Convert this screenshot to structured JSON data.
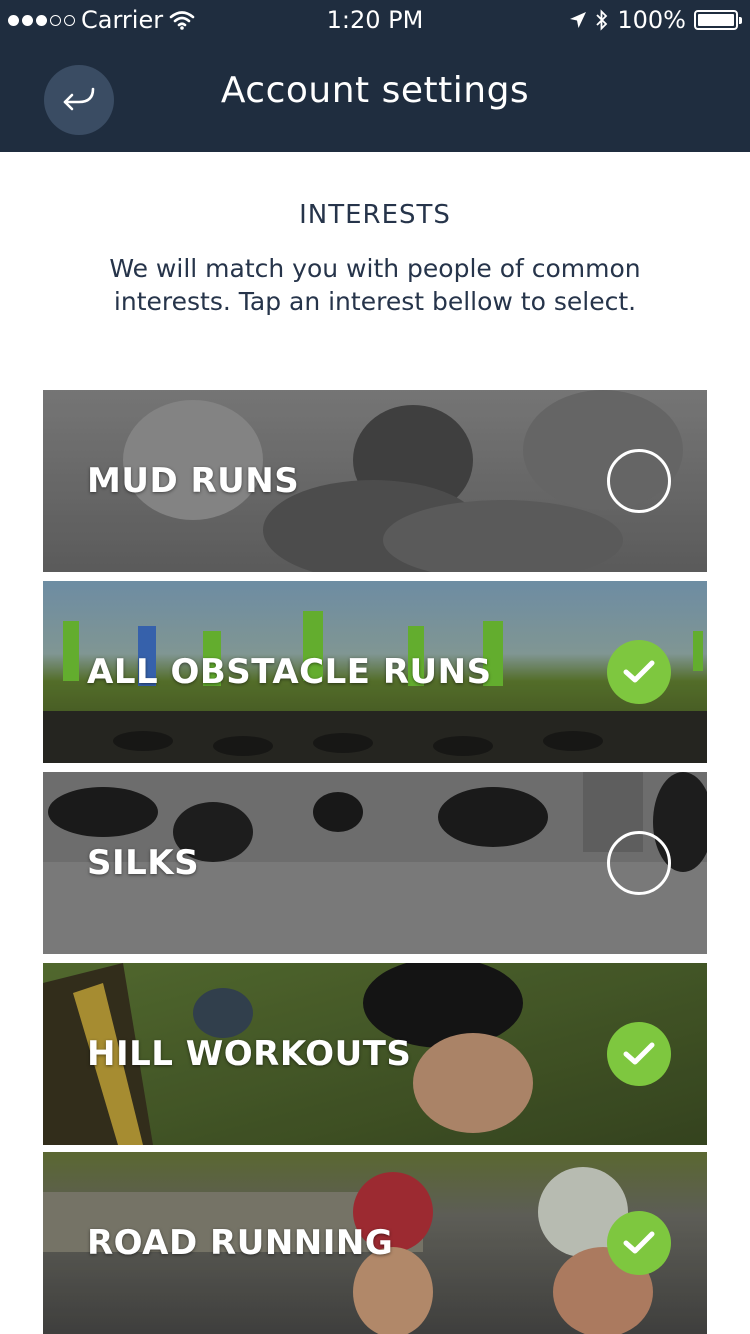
{
  "status_bar": {
    "carrier": "Carrier",
    "time": "1:20 PM",
    "battery": "100%"
  },
  "header": {
    "title": "Account settings"
  },
  "interests": {
    "heading": "INTERESTS",
    "description": "We will match you with people of common interests. Tap an interest bellow to select.",
    "items": [
      {
        "label": "MUD RUNS",
        "selected": false
      },
      {
        "label": "ALL OBSTACLE RUNS",
        "selected": true
      },
      {
        "label": "SILKS",
        "selected": false
      },
      {
        "label": "HILL WORKOUTS",
        "selected": true
      },
      {
        "label": "ROAD RUNNING",
        "selected": true
      }
    ]
  },
  "colors": {
    "header_bg": "#1f2d3f",
    "back_button_bg": "#3a4c63",
    "selected_green": "#7ec73f",
    "text_dark": "#26344a"
  },
  "icons": {
    "back": "back-arrow-icon",
    "checked": "check-icon",
    "unchecked": "empty-circle-icon",
    "wifi": "wifi-icon",
    "location": "location-arrow-icon",
    "bluetooth": "bluetooth-icon",
    "battery": "battery-icon"
  }
}
